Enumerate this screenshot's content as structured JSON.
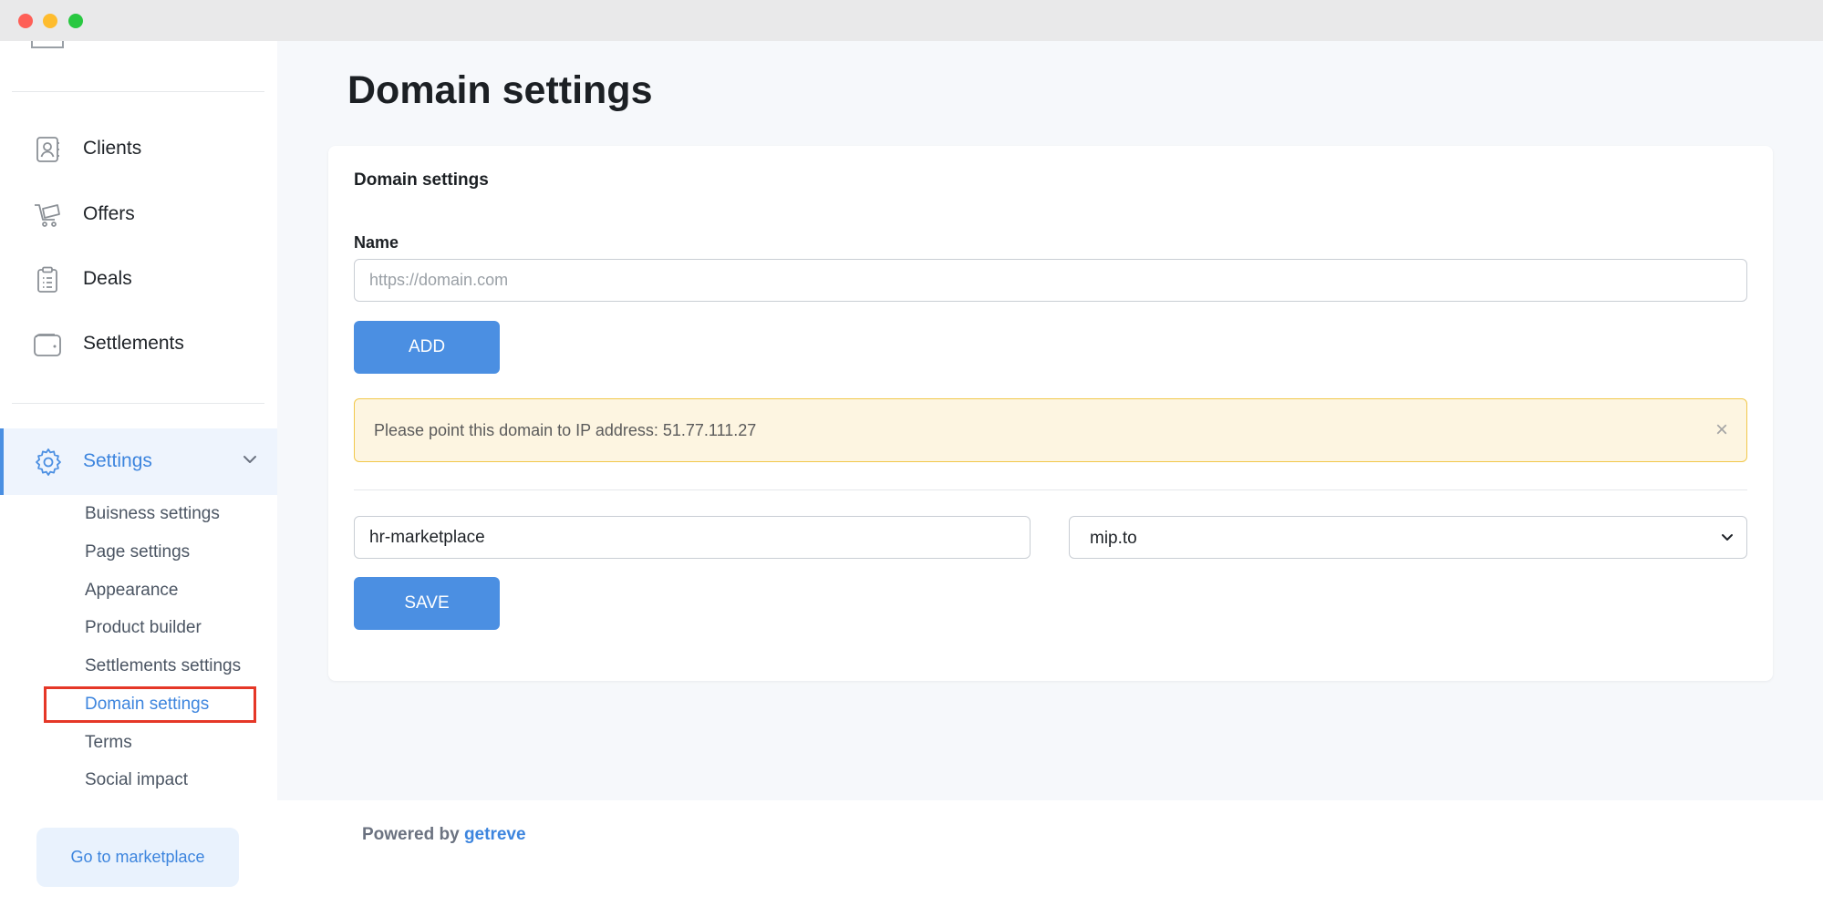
{
  "sidebar": {
    "nav": [
      {
        "label": "Clients",
        "icon": "contact-book-icon"
      },
      {
        "label": "Offers",
        "icon": "cart-icon"
      },
      {
        "label": "Deals",
        "icon": "clipboard-icon"
      },
      {
        "label": "Settlements",
        "icon": "wallet-icon"
      }
    ],
    "settings": {
      "label": "Settings",
      "icon": "gear-icon",
      "expanded": true,
      "items": [
        {
          "label": "Buisness settings"
        },
        {
          "label": "Page settings"
        },
        {
          "label": "Appearance"
        },
        {
          "label": "Product builder"
        },
        {
          "label": "Settlements settings"
        },
        {
          "label": "Domain settings",
          "active": true
        },
        {
          "label": "Terms"
        },
        {
          "label": "Social impact"
        }
      ]
    },
    "marketplace_button": "Go to marketplace"
  },
  "main": {
    "page_title": "Domain settings",
    "card": {
      "title": "Domain settings",
      "name_label": "Name",
      "name_placeholder": "https://domain.com",
      "add_button": "ADD",
      "alert": {
        "text": "Please point this domain to IP address: 51.77.111.27",
        "close": "×"
      },
      "subdomain_value": "hr-marketplace",
      "domain_select_value": "mip.to",
      "save_button": "SAVE"
    }
  },
  "footer": {
    "powered_by": "Powered by",
    "brand": "getreve"
  },
  "colors": {
    "accent": "#4b8fe2",
    "highlight": "#e53727",
    "alert_bg": "#fdf5e1",
    "alert_border": "#f1c84b"
  }
}
